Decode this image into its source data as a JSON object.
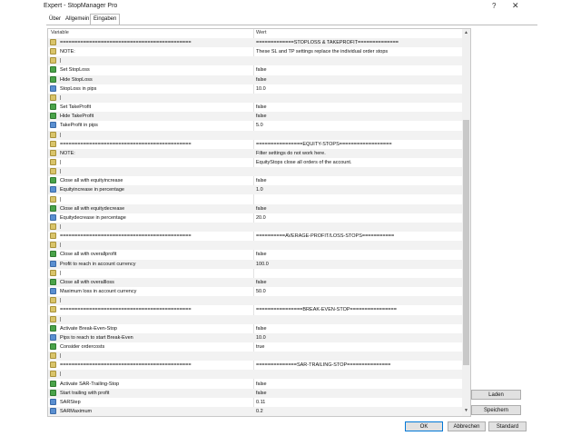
{
  "window": {
    "title": "Expert - StopManager Pro",
    "help": "?",
    "close": "✕"
  },
  "tabs": [
    {
      "label": "Über"
    },
    {
      "label": "Allgemein"
    },
    {
      "label": "Eingaben"
    }
  ],
  "table": {
    "headers": {
      "variable": "Variable",
      "value": "Wert"
    },
    "rows": [
      {
        "icon": "ab",
        "var": "=============================================",
        "val": "=============STOPLOSS & TAKEPROFIT=============="
      },
      {
        "icon": "ab",
        "var": "NOTE:",
        "val": "These SL and TP settings replace the individual order stops"
      },
      {
        "icon": "ab",
        "var": "|",
        "val": ""
      },
      {
        "icon": "bool",
        "var": "Set StopLoss",
        "val": "false"
      },
      {
        "icon": "bool",
        "var": "Hide StopLoss",
        "val": "false"
      },
      {
        "icon": "num",
        "var": "StopLoss in pips",
        "val": "10.0"
      },
      {
        "icon": "ab",
        "var": "|",
        "val": ""
      },
      {
        "icon": "bool",
        "var": "Set TakeProfit",
        "val": "false"
      },
      {
        "icon": "bool",
        "var": "Hide TakeProfit",
        "val": "false"
      },
      {
        "icon": "num",
        "var": "TakeProfit in pips",
        "val": "5.0"
      },
      {
        "icon": "ab",
        "var": "|",
        "val": ""
      },
      {
        "icon": "ab",
        "var": "=============================================",
        "val": "================EQUITY-STOPS=================="
      },
      {
        "icon": "ab",
        "var": "NOTE:",
        "val": "Filter settings do not work here."
      },
      {
        "icon": "ab",
        "var": "|",
        "val": "EquityStops close all orders of the account."
      },
      {
        "icon": "ab",
        "var": "|",
        "val": ""
      },
      {
        "icon": "bool",
        "var": "Close all with equityincrease",
        "val": "false"
      },
      {
        "icon": "num",
        "var": "Equityincrease in percentage",
        "val": "1.0"
      },
      {
        "icon": "ab",
        "var": "|",
        "val": ""
      },
      {
        "icon": "bool",
        "var": "Close all with equitydecrease",
        "val": "false"
      },
      {
        "icon": "num",
        "var": "Equitydecrease in percentage",
        "val": "20.0"
      },
      {
        "icon": "ab",
        "var": "|",
        "val": ""
      },
      {
        "icon": "ab",
        "var": "=============================================",
        "val": "==========AVERAGE-PROFIT/LOSS-STOPS==========="
      },
      {
        "icon": "ab",
        "var": "|",
        "val": ""
      },
      {
        "icon": "bool",
        "var": "Close all with overallprofit",
        "val": "false"
      },
      {
        "icon": "num",
        "var": "Profit to reach in account currency",
        "val": "100.0"
      },
      {
        "icon": "ab",
        "var": "|",
        "val": ""
      },
      {
        "icon": "bool",
        "var": "Close all with overallloss",
        "val": "false"
      },
      {
        "icon": "num",
        "var": "Maximum loss in account currency",
        "val": "50.0"
      },
      {
        "icon": "ab",
        "var": "|",
        "val": ""
      },
      {
        "icon": "ab",
        "var": "=============================================",
        "val": "================BREAK-EVEN-STOP================"
      },
      {
        "icon": "ab",
        "var": "|",
        "val": ""
      },
      {
        "icon": "bool",
        "var": "Activate Break-Even-Stop",
        "val": "false"
      },
      {
        "icon": "num",
        "var": "Pips to reach to start Break-Even",
        "val": "10.0"
      },
      {
        "icon": "bool",
        "var": "Consider ordercosts",
        "val": "true"
      },
      {
        "icon": "ab",
        "var": "|",
        "val": ""
      },
      {
        "icon": "ab",
        "var": "=============================================",
        "val": "==============SAR-TRAILING-STOP==============="
      },
      {
        "icon": "ab",
        "var": "|",
        "val": ""
      },
      {
        "icon": "bool",
        "var": "Activate SAR-Trailing-Stop",
        "val": "false"
      },
      {
        "icon": "bool",
        "var": "Start trailing with profit",
        "val": "false"
      },
      {
        "icon": "num",
        "var": "SARStep",
        "val": "0.11"
      },
      {
        "icon": "num",
        "var": "SARMaximum",
        "val": "0.2"
      }
    ]
  },
  "buttons": {
    "load": "Laden",
    "save": "Speichern",
    "ok": "OK",
    "cancel": "Abbrechen",
    "default": "Standard"
  },
  "scrollbar": {
    "up": "▲",
    "down": "▼"
  }
}
